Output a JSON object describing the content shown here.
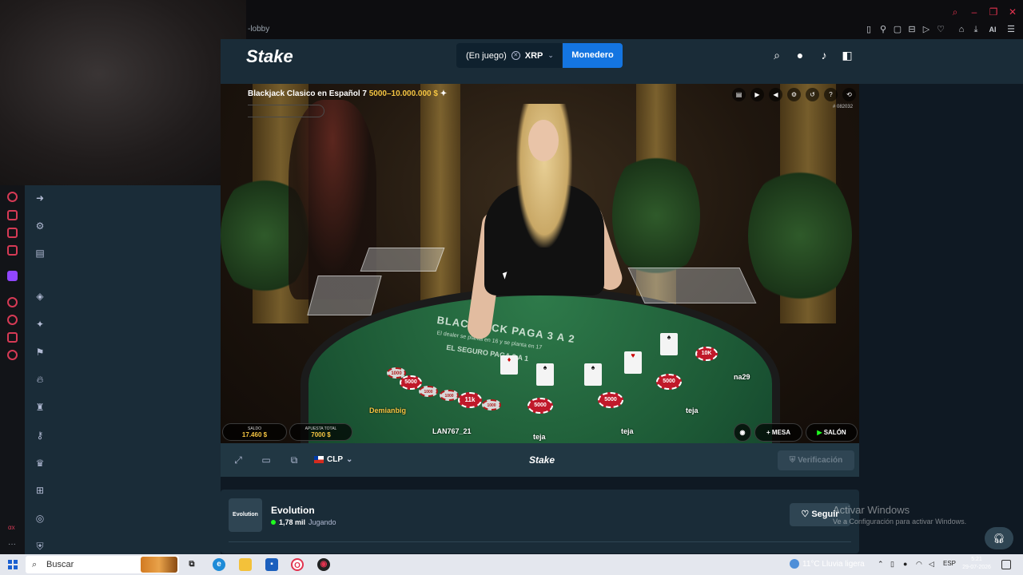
{
  "browser": {
    "url_fragment": "-lobby",
    "toolbar_icons": [
      "sidebar-toggle-icon",
      "pin-icon",
      "screenshot-icon",
      "bookmark-icon",
      "play-icon",
      "heart-icon",
      "wallet-icon",
      "download-icon",
      "translate-icon",
      "ai-icon",
      "menu-icon"
    ],
    "ai_label": "AI",
    "window_controls": [
      "search-icon",
      "minimize-icon",
      "restore-icon",
      "close-icon"
    ]
  },
  "header": {
    "logo": "Stake",
    "balance_status": "(En juego)",
    "currency": "XRP",
    "wallet_label": "Monedero"
  },
  "game": {
    "table_name": "Blackjack Clasico en Español 7",
    "limits": "5000–10.000.000 $",
    "game_id": "# 082032",
    "table_text": "BLACKJACK PAGA 3 A 2",
    "table_text_2": "El dealer se planta en 16 y se planta en 17",
    "table_text_3": "EL SEGURO PAGA 2 A 1",
    "balance_label": "SALDO",
    "balance_value": "17.460 $",
    "total_bet_label": "APUESTA TOTAL",
    "total_bet_value": "7000 $",
    "mesa_label": "MESA",
    "salon_label": "SALÓN",
    "players": [
      "Demianbig",
      "LAN767_21",
      "teja",
      "teja",
      "teja",
      "na29"
    ],
    "chips": [
      "5000",
      "1000",
      "1000",
      "11k",
      "1000",
      "5000",
      "5000",
      "5000",
      "10K",
      "1000"
    ]
  },
  "toolbar": {
    "currency": "CLP",
    "logo": "Stake",
    "verify_label": "Verificación"
  },
  "provider": {
    "logo_text": "Evolution",
    "name": "Evolution",
    "players": "1,78 mil",
    "status": "Jugando",
    "follow_label": "Seguir"
  },
  "watermark": {
    "title": "Activar Windows",
    "subtitle": "Ve a Configuración para activar Windows."
  },
  "taskbar": {
    "search_label": "Buscar",
    "weather": "11°C  Lluvia ligera",
    "lang": "ESP",
    "time": "5:21",
    "date": "29-07-2026"
  },
  "colors": {
    "page_bg": "#0f1923",
    "panel": "#1a2c38",
    "accent_blue": "#1475e1",
    "felt": "#1d5a36",
    "gold": "#f5c542"
  }
}
